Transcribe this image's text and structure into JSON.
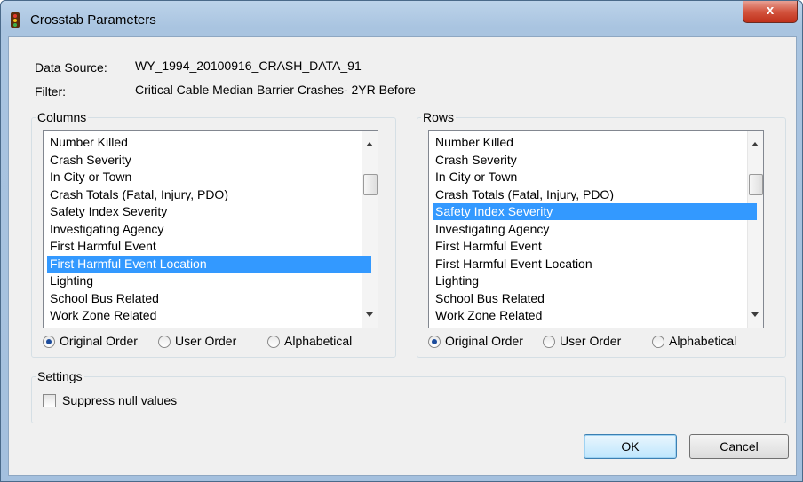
{
  "window": {
    "title": "Crosstab Parameters",
    "close_label": "x"
  },
  "info": {
    "data_source_label": "Data Source:",
    "data_source_value": "WY_1994_20100916_CRASH_DATA_91",
    "filter_label": "Filter:",
    "filter_value": "Critical Cable Median Barrier Crashes- 2YR Before"
  },
  "columns": {
    "title": "Columns",
    "items": [
      "Number Killed",
      "Crash Severity",
      "In City or Town",
      "Crash Totals (Fatal, Injury, PDO)",
      "Safety Index Severity",
      "Investigating Agency",
      "First Harmful Event",
      "First Harmful Event Location",
      "Lighting",
      "School Bus Related",
      "Work Zone Related"
    ],
    "selected": "First Harmful Event Location",
    "order_options": [
      "Original Order",
      "User Order",
      "Alphabetical"
    ],
    "order_selected": "Original Order"
  },
  "rows": {
    "title": "Rows",
    "items": [
      "Number Killed",
      "Crash Severity",
      "In City or Town",
      "Crash Totals (Fatal, Injury, PDO)",
      "Safety Index Severity",
      "Investigating Agency",
      "First Harmful Event",
      "First Harmful Event Location",
      "Lighting",
      "School Bus Related",
      "Work Zone Related"
    ],
    "selected": "Safety Index Severity",
    "order_options": [
      "Original Order",
      "User Order",
      "Alphabetical"
    ],
    "order_selected": "Original Order"
  },
  "settings": {
    "title": "Settings",
    "suppress_label": "Suppress null values",
    "suppress_checked": false
  },
  "buttons": {
    "ok": "OK",
    "cancel": "Cancel"
  },
  "colors": {
    "selection": "#3399ff",
    "title_bar": "#bcd3ea",
    "close_button": "#c0301a"
  }
}
